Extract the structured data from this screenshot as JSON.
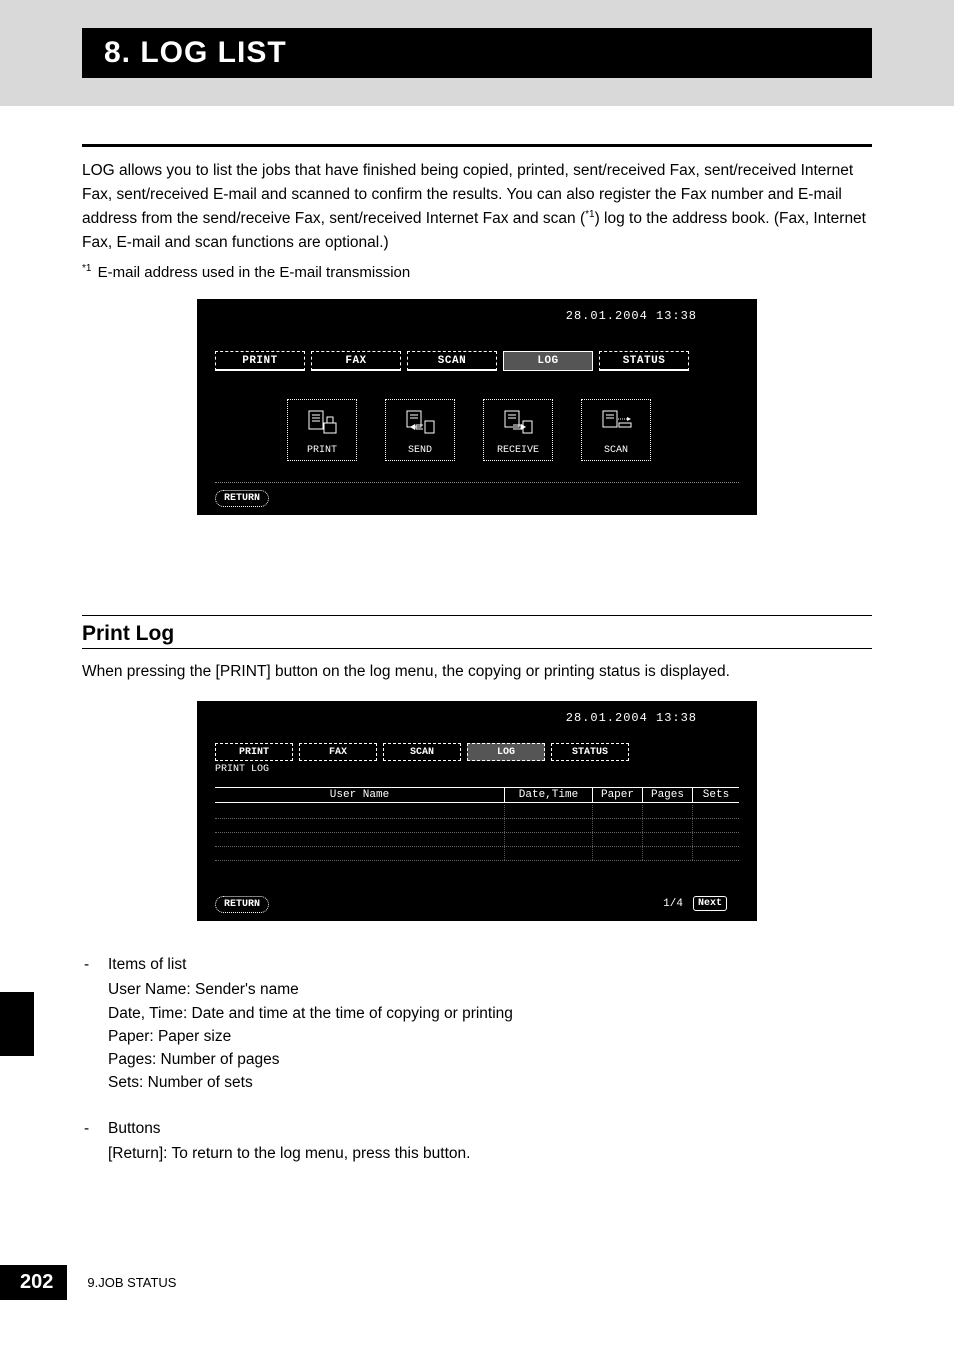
{
  "header": {
    "chapter_title": "8. LOG LIST"
  },
  "intro": {
    "para": "LOG allows you to list the jobs that have finished being copied, printed, sent/received Fax, sent/received Internet Fax, sent/received E-mail and scanned to confirm the results. You can also register the Fax number and E-mail address from the send/receive Fax, sent/received Internet Fax and scan (",
    "sup": "*1",
    "para_cont": ") log to the address book. (Fax, Internet Fax, E-mail and scan functions are optional.)"
  },
  "footnote": {
    "sup": "*1",
    "text": " E-mail address used in the E-mail transmission"
  },
  "screenshot1": {
    "timestamp": "28.01.2004 13:38",
    "tabs": {
      "print": "PRINT",
      "fax": "FAX",
      "scan": "SCAN",
      "log": "LOG",
      "status": "STATUS"
    },
    "log_buttons": {
      "print": "PRINT",
      "send": "SEND",
      "receive": "RECEIVE",
      "scan": "SCAN"
    },
    "return": "RETURN"
  },
  "section": {
    "title": "Print Log",
    "para": "When pressing the [PRINT] button on the log menu, the copying or printing status is displayed."
  },
  "screenshot2": {
    "timestamp": "28.01.2004 13:38",
    "tabs": {
      "print": "PRINT",
      "fax": "FAX",
      "scan": "SCAN",
      "log": "LOG",
      "status": "STATUS"
    },
    "sublabel": "PRINT LOG",
    "columns": {
      "user": "User Name",
      "datetime": "Date,Time",
      "paper": "Paper",
      "pages": "Pages",
      "sets": "Sets"
    },
    "return": "RETURN",
    "page_indicator": "1/4",
    "next": "Next"
  },
  "items_list": {
    "heading": "Items of list",
    "line1": "User Name: Sender's name",
    "line2": "Date, Time: Date and time at the time of copying or printing",
    "line3": "Paper: Paper size",
    "line4": "Pages: Number of pages",
    "line5": "Sets: Number of sets"
  },
  "buttons_list": {
    "heading": "Buttons",
    "line1": "[Return]: To return to the log menu, press this button."
  },
  "footer": {
    "page_number": "202",
    "chapter": "9.JOB STATUS"
  }
}
